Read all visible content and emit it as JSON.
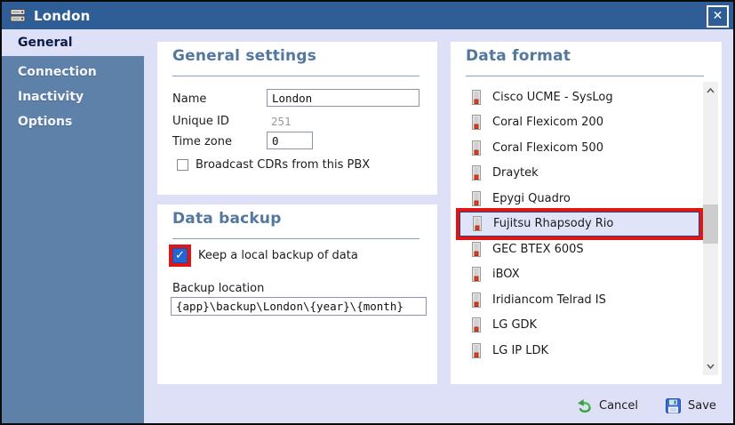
{
  "window": {
    "title": "London",
    "close_glyph": "✕"
  },
  "sidebar": {
    "items": [
      {
        "label": "General",
        "active": true
      },
      {
        "label": "Connection",
        "active": false
      },
      {
        "label": "Inactivity",
        "active": false
      },
      {
        "label": "Options",
        "active": false
      }
    ]
  },
  "general": {
    "title": "General settings",
    "name_label": "Name",
    "name_value": "London",
    "unique_id_label": "Unique ID",
    "unique_id_value": "251",
    "time_zone_label": "Time zone",
    "time_zone_value": "0",
    "broadcast_label": "Broadcast CDRs from this PBX",
    "broadcast_checked": false
  },
  "backup": {
    "title": "Data backup",
    "keep_label": "Keep a local backup of data",
    "keep_checked": true,
    "check_glyph": "✓",
    "location_label": "Backup location",
    "location_value": "{app}\\backup\\London\\{year}\\{month}"
  },
  "format": {
    "title": "Data format",
    "items": [
      "Cisco UCME - SysLog",
      "Coral Flexicom 200",
      "Coral Flexicom 500",
      "Draytek",
      "Epygi Quadro",
      "Fujitsu Rhapsody Rio",
      "GEC BTEX 600S",
      "iBOX",
      "Iridiancom Telrad IS",
      "LG GDK",
      "LG IP LDK"
    ],
    "selected_item": "Fujitsu Rhapsody Rio"
  },
  "footer": {
    "cancel_label": "Cancel",
    "save_label": "Save"
  },
  "colors": {
    "titlebar": "#2f5e96",
    "sidebar": "#5e81a9",
    "background": "#dde0f6",
    "heading": "#53779f",
    "annotation_red": "#e01616",
    "selected_bg": "#e0e4f8",
    "selected_border": "#2b3f87",
    "checkbox_blue": "#2565cf"
  }
}
